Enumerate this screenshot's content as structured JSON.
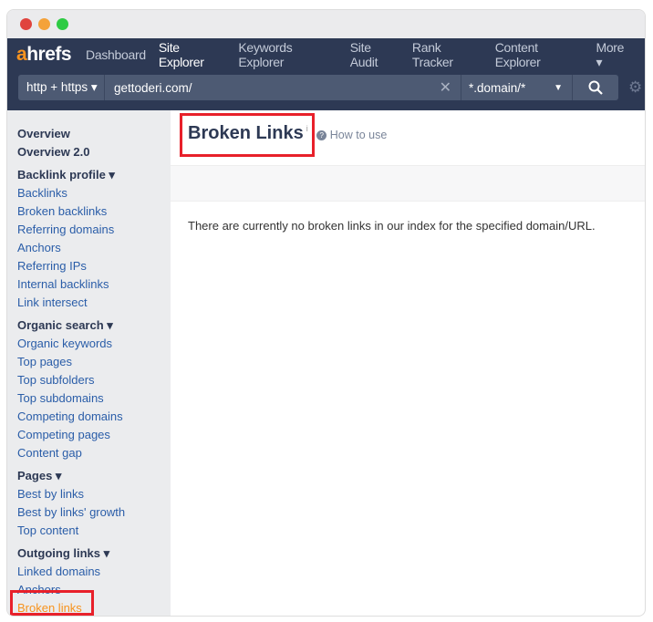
{
  "nav": {
    "logo": "ahrefs",
    "items": [
      "Dashboard",
      "Site Explorer",
      "Keywords Explorer",
      "Site Audit",
      "Rank Tracker",
      "Content Explorer",
      "More ▾"
    ],
    "active": "Site Explorer"
  },
  "search": {
    "protocol": "http + https ▾",
    "url": "gettoderi.com/",
    "mode": "*.domain/*"
  },
  "sidebar": [
    {
      "label": "Overview",
      "type": "h"
    },
    {
      "label": "Overview 2.0",
      "type": "h"
    },
    {
      "label": "Backlink profile ▾",
      "type": "h",
      "gap": true
    },
    {
      "label": "Backlinks"
    },
    {
      "label": "Broken backlinks"
    },
    {
      "label": "Referring domains"
    },
    {
      "label": "Anchors"
    },
    {
      "label": "Referring IPs"
    },
    {
      "label": "Internal backlinks"
    },
    {
      "label": "Link intersect"
    },
    {
      "label": "Organic search ▾",
      "type": "h",
      "gap": true
    },
    {
      "label": "Organic keywords"
    },
    {
      "label": "Top pages"
    },
    {
      "label": "Top subfolders"
    },
    {
      "label": "Top subdomains"
    },
    {
      "label": "Competing domains"
    },
    {
      "label": "Competing pages"
    },
    {
      "label": "Content gap"
    },
    {
      "label": "Pages ▾",
      "type": "h",
      "gap": true
    },
    {
      "label": "Best by links"
    },
    {
      "label": "Best by links' growth"
    },
    {
      "label": "Top content"
    },
    {
      "label": "Outgoing links ▾",
      "type": "h",
      "gap": true
    },
    {
      "label": "Linked domains"
    },
    {
      "label": "Anchors"
    },
    {
      "label": "Broken links",
      "current": true
    }
  ],
  "main": {
    "title": "Broken Links",
    "info": "i",
    "how_to_use": "How to use",
    "message": "There are currently no broken links in our index for the specified domain/URL."
  },
  "colors": {
    "nav": "#2d3954",
    "accent": "#f7931e",
    "highlight": "#e8202a",
    "link": "#2a5da8"
  }
}
